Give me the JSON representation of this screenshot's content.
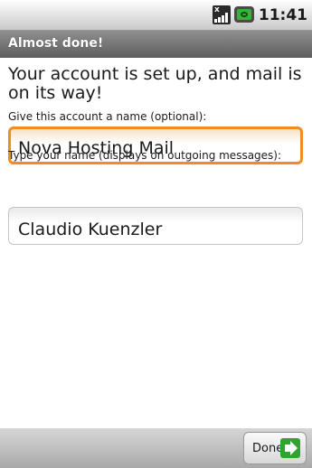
{
  "status_bar": {
    "time": "11:41",
    "signal_icon": "signal-roaming-icon",
    "battery_icon": "battery-charging-icon"
  },
  "title_bar": {
    "title": "Almost done!"
  },
  "form": {
    "heading": "Your account is set up, and mail is on its way!",
    "account_name_label": "Give this account a name (optional):",
    "account_name_value": "Nova Hosting Mail",
    "sender_name_label": "Type your name (displays on outgoing messages):",
    "sender_name_value": "Claudio Kuenzler"
  },
  "footer": {
    "done_label": "Done",
    "done_icon": "forward-arrow-icon"
  },
  "colors": {
    "focus_border": "#f08c20",
    "title_bar": "#6e6e6e",
    "done_icon": "#2fa52f"
  }
}
